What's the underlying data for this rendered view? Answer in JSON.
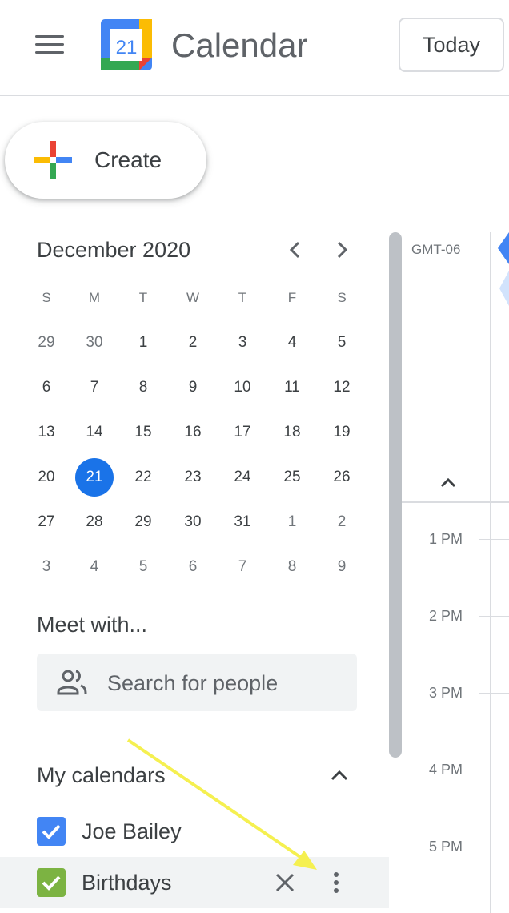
{
  "header": {
    "logo_day": "21",
    "app_title": "Calendar",
    "today_label": "Today"
  },
  "create": {
    "label": "Create"
  },
  "mini_calendar": {
    "month_title": "December 2020",
    "weekdays": [
      "S",
      "M",
      "T",
      "W",
      "T",
      "F",
      "S"
    ],
    "weeks": [
      [
        {
          "d": "29",
          "o": true
        },
        {
          "d": "30",
          "o": true
        },
        {
          "d": "1"
        },
        {
          "d": "2"
        },
        {
          "d": "3"
        },
        {
          "d": "4"
        },
        {
          "d": "5"
        }
      ],
      [
        {
          "d": "6"
        },
        {
          "d": "7"
        },
        {
          "d": "8"
        },
        {
          "d": "9"
        },
        {
          "d": "10"
        },
        {
          "d": "11"
        },
        {
          "d": "12"
        }
      ],
      [
        {
          "d": "13"
        },
        {
          "d": "14"
        },
        {
          "d": "15"
        },
        {
          "d": "16"
        },
        {
          "d": "17"
        },
        {
          "d": "18"
        },
        {
          "d": "19"
        }
      ],
      [
        {
          "d": "20"
        },
        {
          "d": "21",
          "today": true
        },
        {
          "d": "22"
        },
        {
          "d": "23"
        },
        {
          "d": "24"
        },
        {
          "d": "25"
        },
        {
          "d": "26"
        }
      ],
      [
        {
          "d": "27"
        },
        {
          "d": "28"
        },
        {
          "d": "29"
        },
        {
          "d": "30"
        },
        {
          "d": "31"
        },
        {
          "d": "1",
          "o": true
        },
        {
          "d": "2",
          "o": true
        }
      ],
      [
        {
          "d": "3",
          "o": true
        },
        {
          "d": "4",
          "o": true
        },
        {
          "d": "5",
          "o": true
        },
        {
          "d": "6",
          "o": true
        },
        {
          "d": "7",
          "o": true
        },
        {
          "d": "8",
          "o": true
        },
        {
          "d": "9",
          "o": true
        }
      ]
    ]
  },
  "meet": {
    "title": "Meet with...",
    "search_placeholder": "Search for people"
  },
  "my_calendars": {
    "title": "My calendars",
    "items": [
      {
        "label": "Joe Bailey",
        "color": "#4285f4",
        "checked": true
      },
      {
        "label": "Birthdays",
        "color": "#7cb342",
        "checked": true
      }
    ]
  },
  "day_view": {
    "timezone": "GMT-06",
    "hours": [
      "1 PM",
      "2 PM",
      "3 PM",
      "4 PM",
      "5 PM"
    ]
  },
  "colors": {
    "accent": "#1a73e8",
    "annotation": "#f5f050"
  }
}
